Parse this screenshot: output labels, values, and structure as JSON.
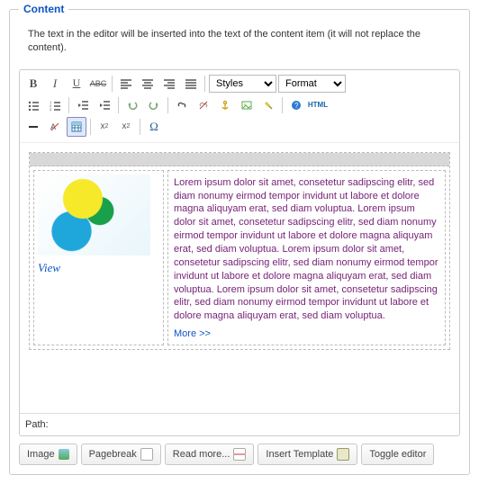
{
  "fieldset_title": "Content",
  "intro_text": "The text in the editor will be inserted into the text of the content item (it will not replace the content).",
  "toolbar": {
    "bold": "B",
    "italic": "I",
    "underline": "U",
    "strike": "ABC",
    "styles_label": "Styles",
    "format_label": "Format",
    "html_label": "HTML"
  },
  "content": {
    "view_label": "View",
    "lorem": "Lorem ipsum dolor sit amet, consetetur sadipscing elitr, sed diam nonumy eirmod tempor invidunt ut labore et dolore magna aliquyam erat, sed diam voluptua. Lorem ipsum dolor sit amet, consetetur sadipscing elitr, sed diam nonumy eirmod tempor invidunt ut labore et dolore magna aliquyam erat, sed diam voluptua. Lorem ipsum dolor sit amet, consetetur sadipscing elitr, sed diam nonumy eirmod tempor invidunt ut labore et dolore magna aliquyam erat, sed diam voluptua. Lorem ipsum dolor sit amet, consetetur sadipscing elitr, sed diam nonumy eirmod tempor invidunt ut labore et dolore magna aliquyam erat, sed diam voluptua.",
    "more_label": "More >>"
  },
  "path_label": "Path:",
  "buttons": {
    "image": "Image",
    "pagebreak": "Pagebreak",
    "readmore": "Read more...",
    "insert_template": "Insert Template",
    "toggle": "Toggle editor"
  }
}
